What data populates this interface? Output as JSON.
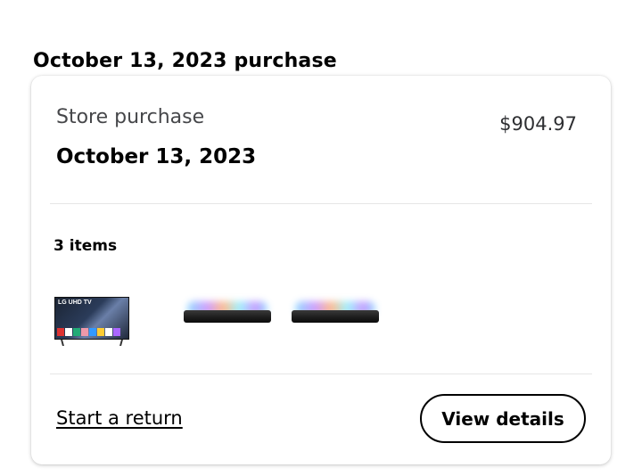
{
  "heading": "October 13, 2023 purchase",
  "order": {
    "store_label": "Store purchase",
    "total": "$904.97",
    "date": "October 13, 2023",
    "items_count_label": "3 items",
    "items": [
      {
        "name": "lg-uhd-tv-thumbnail",
        "brand_text": "LG UHD TV"
      },
      {
        "name": "soundbar-thumbnail"
      },
      {
        "name": "soundbar-thumbnail"
      }
    ]
  },
  "actions": {
    "start_return": "Start a return",
    "view_details": "View details"
  },
  "colors": {
    "text": "#000000",
    "muted_text": "#46474a",
    "divider": "#e6e6e6",
    "card_bg": "#ffffff"
  }
}
